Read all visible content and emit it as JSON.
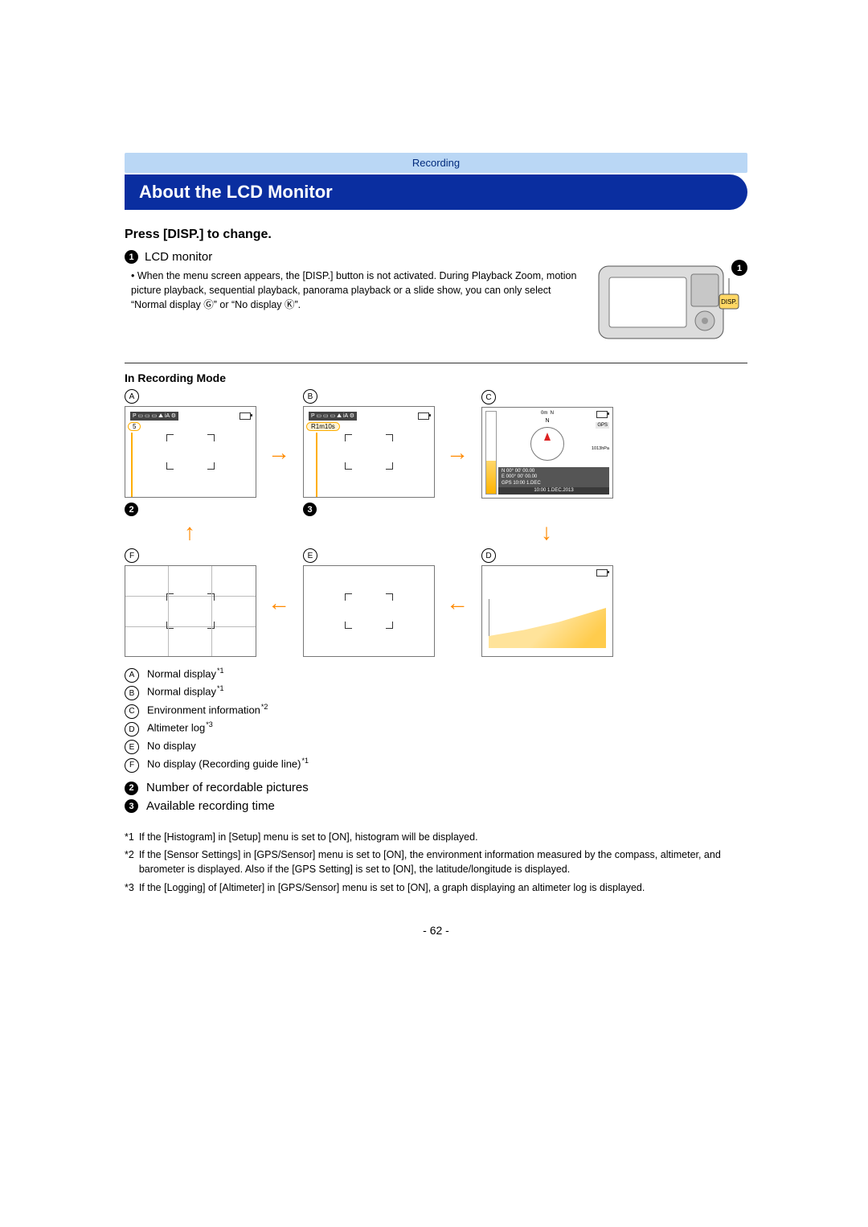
{
  "header": {
    "breadcrumb": "Recording",
    "title": "About the LCD Monitor"
  },
  "intro": {
    "subhead": "Press [DISP.] to change.",
    "item1": {
      "num": "1",
      "label": "LCD monitor"
    },
    "bullet": "When the menu screen appears, the [DISP.] button is not activated. During Playback Zoom, motion picture playback, sequential playback, panorama playback or a slide show, you can only select “Normal display Ⓖ” or “No display Ⓚ”.",
    "disp_button_label": "DISP."
  },
  "recording": {
    "mode_label": "In Recording Mode",
    "labels": {
      "A": "A",
      "B": "B",
      "C": "C",
      "D": "D",
      "E": "E",
      "F": "F"
    },
    "screenA": {
      "count": "5",
      "icons": "P ▭ ▭ ▭ ⛰ iA ⚙"
    },
    "screenB": {
      "time": "R1m10s",
      "icons": "P ▭ ▭ ▭ ⛰ iA ⚙"
    },
    "screenC": {
      "altitude": "0m",
      "direction_top": "N",
      "compass_n": "N",
      "gps_rows": [
        "N     00° 00' 00.00",
        "E     000° 00' 00.00",
        "GPS  10:00  1.DEC"
      ],
      "footer": "10:00  1.DEC.2013",
      "pressure": "1013hPa",
      "gps_icon": "GPS"
    },
    "under_badges": {
      "b2": "2",
      "b3": "3"
    },
    "legend": [
      {
        "k": "A",
        "t": "Normal display",
        "sup": "*1"
      },
      {
        "k": "B",
        "t": "Normal display",
        "sup": "*1"
      },
      {
        "k": "C",
        "t": "Environment information",
        "sup": "*2"
      },
      {
        "k": "D",
        "t": "Altimeter log",
        "sup": "*3"
      },
      {
        "k": "E",
        "t": "No display",
        "sup": ""
      },
      {
        "k": "F",
        "t": "No display (Recording guide line)",
        "sup": "*1"
      }
    ],
    "numbered": [
      {
        "k": "2",
        "t": "Number of recordable pictures"
      },
      {
        "k": "3",
        "t": "Available recording time"
      }
    ],
    "footnotes": [
      {
        "k": "*1",
        "t": "If the [Histogram] in [Setup] menu is set to [ON], histogram will be displayed."
      },
      {
        "k": "*2",
        "t": "If the [Sensor Settings] in [GPS/Sensor] menu is set to [ON], the environment information measured by the compass, altimeter, and barometer is displayed. Also if the [GPS Setting] is set to [ON], the latitude/longitude is displayed."
      },
      {
        "k": "*3",
        "t": "If the [Logging] of [Altimeter] in [GPS/Sensor] menu is set to [ON], a graph displaying an altimeter log is displayed."
      }
    ]
  },
  "page_number": "- 62 -"
}
